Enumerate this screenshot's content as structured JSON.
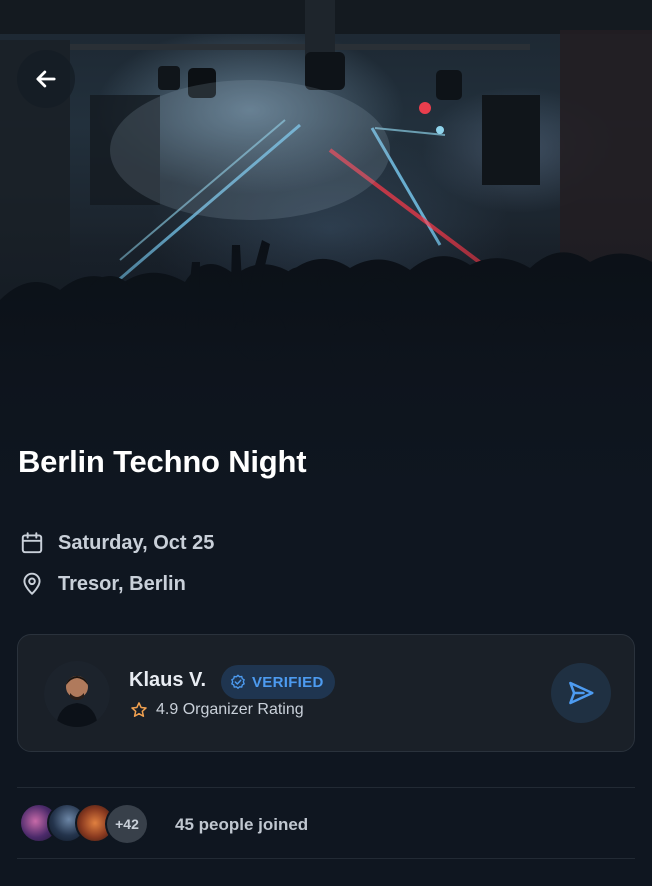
{
  "event": {
    "title": "Berlin Techno Night",
    "date": "Saturday, Oct 25",
    "location": "Tresor, Berlin"
  },
  "organizer": {
    "name": "Klaus V.",
    "badge": "VERIFIED",
    "rating_text": "4.9 Organizer Rating"
  },
  "attendees": {
    "extra_count": "+42",
    "joined_text": "45 people joined"
  },
  "colors": {
    "background": "#0f1620",
    "card": "#1a2028",
    "accent_blue": "#4d9bf0",
    "star_orange": "#f0a050"
  },
  "icons": {
    "back": "arrow-left-icon",
    "date": "calendar-icon",
    "location": "map-pin-icon",
    "verified": "verified-check-icon",
    "rating": "star-icon",
    "message": "send-icon"
  }
}
